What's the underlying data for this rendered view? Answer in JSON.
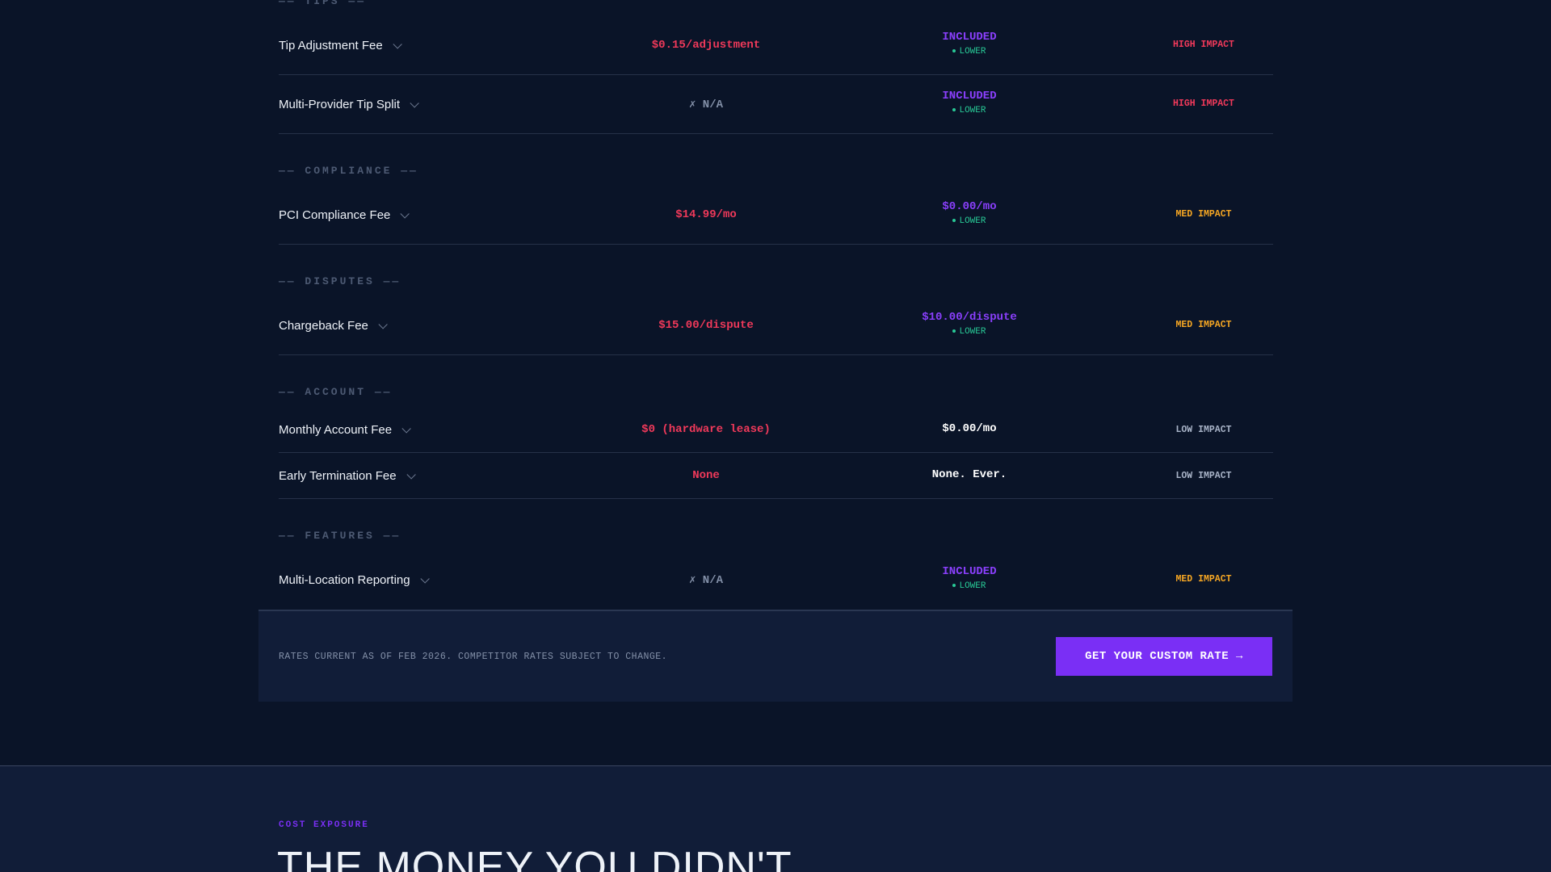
{
  "colors": {
    "competitor_red": "#f0395a",
    "ours_purple": "#8a3ffc",
    "lower_green": "#28c996",
    "high_impact": "#f0395a",
    "med_impact": "#f5a623",
    "low_impact": "#a8b3c7",
    "cta_bg": "#7a2ff5"
  },
  "sections": {
    "tips": "—— TIPS ——",
    "compliance": "—— COMPLIANCE ——",
    "disputes": "—— DISPUTES ——",
    "account": "—— ACCOUNT ——",
    "features": "—— FEATURES ——"
  },
  "rows": [
    {
      "name": "Tip Adjustment Fee",
      "competitor": "$0.15/adjustment",
      "ours": "INCLUDED",
      "ours_note": "LOWER",
      "impact": "HIGH IMPACT"
    },
    {
      "name": "Multi-Provider Tip Split",
      "competitor": "✗ N/A",
      "ours": "INCLUDED",
      "ours_note": "LOWER",
      "impact": "HIGH IMPACT"
    },
    {
      "name": "PCI Compliance Fee",
      "competitor": "$14.99/mo",
      "ours": "$0.00/mo",
      "ours_note": "LOWER",
      "impact": "MED IMPACT"
    },
    {
      "name": "Chargeback Fee",
      "competitor": "$15.00/dispute",
      "ours": "$10.00/dispute",
      "ours_note": "LOWER",
      "impact": "MED IMPACT"
    },
    {
      "name": "Monthly Account Fee",
      "competitor": "$0 (hardware lease)",
      "ours": "$0.00/mo",
      "impact": "LOW IMPACT"
    },
    {
      "name": "Early Termination Fee",
      "competitor": "None",
      "ours": "None. Ever.",
      "impact": "LOW IMPACT"
    },
    {
      "name": "Multi-Location Reporting",
      "competitor": "✗ N/A",
      "ours": "INCLUDED",
      "ours_note": "LOWER",
      "impact": "MED IMPACT"
    }
  ],
  "footer": {
    "note": "RATES CURRENT AS OF FEB 2026. COMPETITOR RATES SUBJECT TO CHANGE.",
    "cta_label": "GET YOUR CUSTOM RATE →"
  },
  "cost_exposure": {
    "eyebrow": "COST EXPOSURE",
    "title": "THE MONEY YOU DIDN'T"
  }
}
